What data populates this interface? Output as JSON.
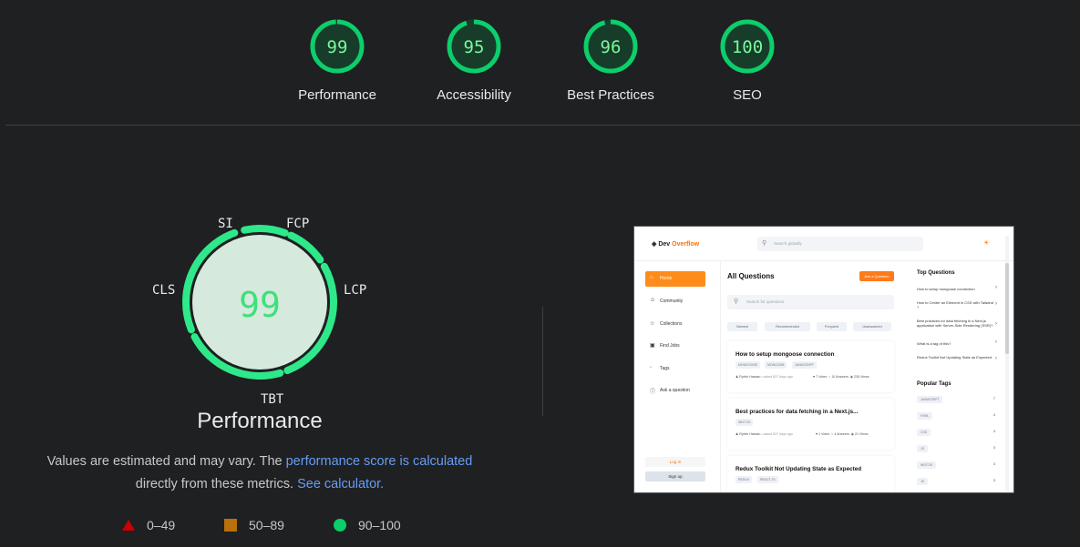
{
  "summary": {
    "gauges": [
      {
        "score": "99",
        "label": "Performance",
        "fraction": 0.99
      },
      {
        "score": "95",
        "label": "Accessibility",
        "fraction": 0.95
      },
      {
        "score": "96",
        "label": "Best Practices",
        "fraction": 0.96
      },
      {
        "score": "100",
        "label": "SEO",
        "fraction": 1.0
      }
    ]
  },
  "colors": {
    "pass": "#0cce6b",
    "pass_text": "#79f79b",
    "pass_fill": "#173d2a",
    "link": "#669df6",
    "fail": "#cc0000",
    "average": "#b8700c"
  },
  "performance": {
    "score": "99",
    "title": "Performance",
    "metrics": {
      "si": "SI",
      "fcp": "FCP",
      "lcp": "LCP",
      "tbt": "TBT",
      "cls": "CLS"
    },
    "description_prefix": "Values are estimated and may vary. The ",
    "description_link": "performance score is calculated",
    "description_middle": "directly from these metrics.",
    "calculator_link": "See calculator."
  },
  "legend": {
    "fail": "0–49",
    "average": "50–89",
    "pass": "90–100"
  },
  "screenshot": {
    "logo_prefix": "Dev",
    "logo_suffix": "Overflow",
    "global_search": "Search globally",
    "nav": [
      "Home",
      "Community",
      "Collections",
      "Find Jobs",
      "Tags",
      "Ask a question"
    ],
    "login": "Log In",
    "signup": "Sign up",
    "main_title": "All Questions",
    "ask_button": "Ask a Question",
    "question_search": "Search for questions",
    "filters": [
      "Newest",
      "Recommended",
      "Frequent",
      "Unanswered"
    ],
    "questions": [
      {
        "title": "How to setup mongoose connection",
        "tags": [
          "MONGOOSE",
          "MONGODB",
          "JAVASCRIPT"
        ],
        "author": "Ryeitz Hassan",
        "asked": "• asked 837 days ago",
        "votes": "7 Votes",
        "answers": "10 Answers",
        "views": "236 Views"
      },
      {
        "title": "Best practices for data fetching in a Next.js...",
        "tags": [
          "NEXTJS"
        ],
        "author": "Ryeitz Hassan",
        "asked": "• asked 837 days ago",
        "votes": "1 Votes",
        "answers": "4 Answers",
        "views": "21 Views"
      },
      {
        "title": "Redux Toolkit Not Updating State as Expected",
        "tags": [
          "REDUX",
          "REACT.JS"
        ]
      }
    ],
    "top_questions_title": "Top Questions",
    "top_questions": [
      "How to setup mongoose connection",
      "How to Center an Element in CSS with Tailwind ?",
      "Best practices for data fetching in a Next.js application with Server-Side Rendering (SSR)?",
      "What is a tag of this?",
      "Redux Toolkit Not Updating State as Expected"
    ],
    "popular_tags_title": "Popular Tags",
    "popular_tags": [
      "JAVASCRIPT",
      "HTML",
      "CSS",
      "JS",
      "NEXTJS",
      "JS"
    ],
    "popular_tag_counts": [
      "7",
      "4",
      "4",
      "3",
      "3",
      "3"
    ]
  }
}
